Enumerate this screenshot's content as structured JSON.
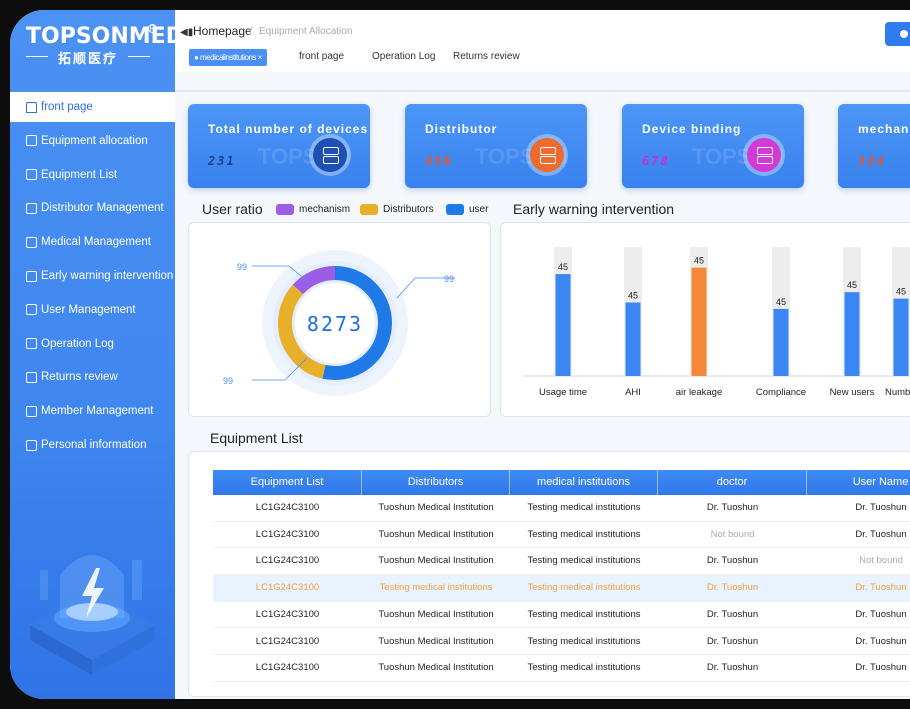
{
  "logo": {
    "brand": "TOPSONMED",
    "registered": "R",
    "chinese": "拓顺医疗"
  },
  "sidebar": {
    "items": [
      {
        "label": "front page",
        "icon": "home-icon",
        "active": true
      },
      {
        "label": "Equipment allocation",
        "icon": "edit-icon"
      },
      {
        "label": "Equipment List",
        "icon": "list-icon"
      },
      {
        "label": "Distributor Management",
        "icon": "users-icon"
      },
      {
        "label": "Medical  Management",
        "icon": "building-icon"
      },
      {
        "label": "Early warning intervention",
        "icon": "bell-icon"
      },
      {
        "label": "User Management",
        "icon": "user-icon"
      },
      {
        "label": "Operation Log",
        "icon": "log-icon"
      },
      {
        "label": "Returns review",
        "icon": "return-icon"
      },
      {
        "label": "Member Management",
        "icon": "member-icon"
      },
      {
        "label": "Personal information",
        "icon": "id-card-icon"
      }
    ]
  },
  "header": {
    "breadcrumb_home": "Homepage",
    "breadcrumb_sep": "/",
    "breadcrumb_current": "Equipment Allocation",
    "active_tab": "● medicalinstitutions ×",
    "tabs": [
      "front page",
      "Operation Log",
      "Returns review"
    ]
  },
  "cards": [
    {
      "title": "Total number of devices",
      "value": "231",
      "value_color": "#1e3f8a",
      "icon_color": "#1d4fb4",
      "icon": "server-icon",
      "watermark": "TOPSON"
    },
    {
      "title": "Distributor",
      "value": "456",
      "value_color": "#e8542a",
      "icon_color": "#ef6a2e",
      "icon": "server-icon",
      "watermark": "TOPSON"
    },
    {
      "title": "Device binding",
      "value": "678",
      "value_color": "#c82fd0",
      "icon_color": "#d23ad8",
      "icon": "server-icon",
      "watermark": "TOPSON"
    },
    {
      "title": "mechan",
      "value": "334",
      "value_color": "#e8542a",
      "icon_color": "#ef6a2e",
      "icon": "server-icon",
      "watermark": ""
    }
  ],
  "user_ratio": {
    "title": "User ratio",
    "legend": [
      {
        "label": "mechanism",
        "color": "#9b5de5"
      },
      {
        "label": "Distributors",
        "color": "#e8b02a"
      },
      {
        "label": "user",
        "color": "#1f7ae8"
      }
    ],
    "center_value": "8273",
    "callouts": [
      "99",
      "99",
      "99"
    ]
  },
  "chart_data": {
    "type": "bar",
    "title": "Early warning intervention",
    "categories": [
      "Usage time",
      "AHI",
      "air leakage",
      "Compliance",
      "New users",
      "Numb"
    ],
    "values": [
      45,
      45,
      45,
      45,
      45,
      45
    ],
    "bar_levels": [
      0.79,
      0.57,
      0.84,
      0.52,
      0.65,
      0.6
    ],
    "highlight_index": 2,
    "colors": {
      "bar": "#3a86f2",
      "highlight": "#f4873a",
      "track": "#ededed"
    }
  },
  "equipment_list": {
    "title": "Equipment List",
    "columns": [
      "Equipment List",
      "Distributors",
      "medical institutions",
      "doctor",
      "User Name"
    ],
    "rows": [
      [
        "LC1G24C3100",
        "Tuoshun Medical Institution",
        "Testing medical institutions",
        "Dr. Tuoshun",
        "Dr. Tuoshun"
      ],
      [
        "LC1G24C3100",
        "Tuoshun Medical Institution",
        "Testing medical institutions",
        "Not bound",
        "Dr. Tuoshun"
      ],
      [
        "LC1G24C3100",
        "Tuoshun Medical Institution",
        "Testing medical institutions",
        "Dr. Tuoshun",
        "Not bound"
      ],
      [
        "LC1G24C3100",
        "Testing medical institutions",
        "Testing medical institutions",
        "Dr. Tuoshun",
        "Dr. Tuoshun"
      ],
      [
        "LC1G24C3100",
        "Tuoshun Medical Institution",
        "Testing medical institutions",
        "Dr. Tuoshun",
        "Dr. Tuoshun"
      ],
      [
        "LC1G24C3100",
        "Tuoshun Medical Institution",
        "Testing medical institutions",
        "Dr. Tuoshun",
        "Dr. Tuoshun"
      ],
      [
        "LC1G24C3100",
        "Tuoshun Medical Institution",
        "Testing medical institutions",
        "Dr. Tuoshun",
        "Dr. Tuoshun"
      ]
    ],
    "highlight_row": 3
  }
}
